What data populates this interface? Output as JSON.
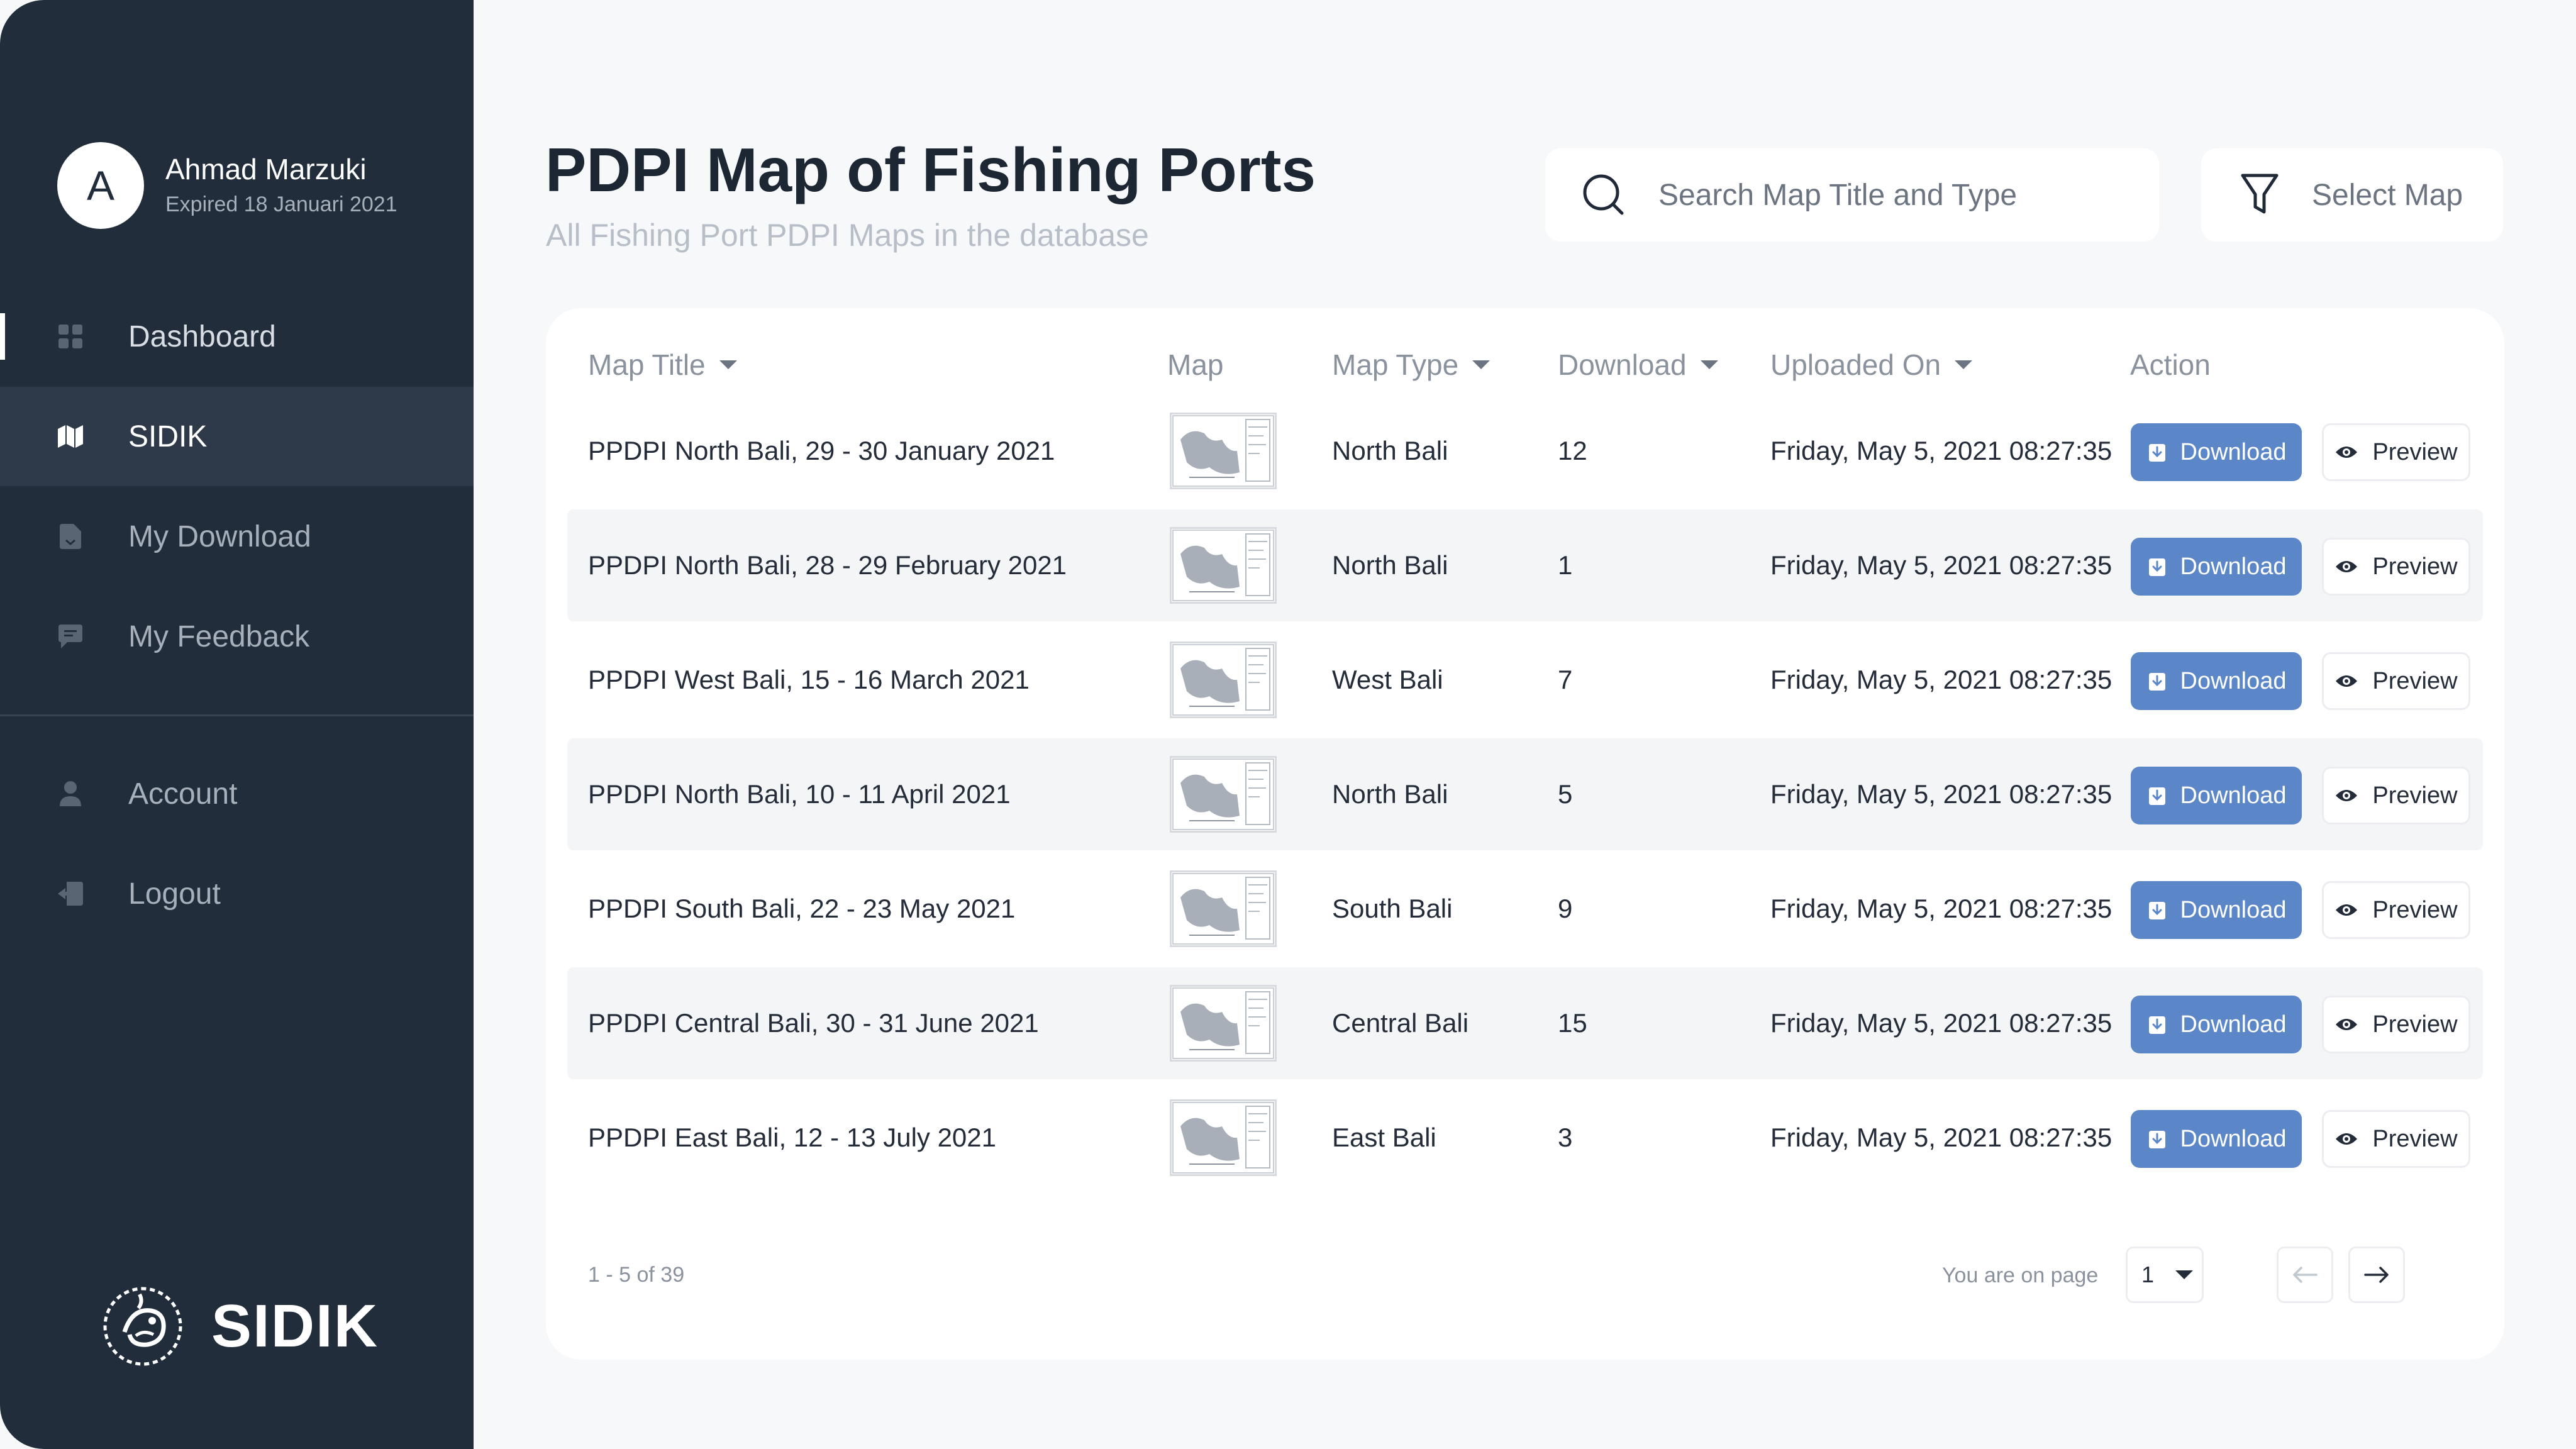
{
  "user": {
    "initial": "A",
    "name": "Ahmad Marzuki",
    "status": "Expired 18 Januari 2021"
  },
  "nav": {
    "items": [
      {
        "label": "Dashboard",
        "icon": "grid-icon"
      },
      {
        "label": "SIDIK",
        "icon": "map-icon"
      },
      {
        "label": "My Download",
        "icon": "document-icon"
      },
      {
        "label": "My Feedback",
        "icon": "chat-icon"
      }
    ],
    "secondary": [
      {
        "label": "Account",
        "icon": "user-icon"
      },
      {
        "label": "Logout",
        "icon": "logout-icon"
      }
    ],
    "active_index": 1
  },
  "brand": {
    "name": "SIDIK",
    "logo_icon": "fish-emblem-icon"
  },
  "page": {
    "title": "PDPI Map of Fishing Ports",
    "subtitle": "All Fishing Port PDPI Maps in the database"
  },
  "search": {
    "placeholder": "Search Map Title and Type",
    "value": ""
  },
  "filter": {
    "label": "Select Map"
  },
  "table": {
    "headers": {
      "title": "Map Title",
      "map": "Map",
      "type": "Map Type",
      "download": "Download",
      "uploaded": "Uploaded On",
      "action": "Action"
    },
    "rows": [
      {
        "title": "PPDPI North Bali, 29 - 30 January 2021",
        "type": "North Bali",
        "downloads": "12",
        "uploaded": "Friday, May 5, 2021 08:27:35"
      },
      {
        "title": "PPDPI North Bali, 28 - 29 February 2021",
        "type": "North Bali",
        "downloads": "1",
        "uploaded": "Friday, May 5, 2021 08:27:35"
      },
      {
        "title": "PPDPI West Bali, 15 - 16 March 2021",
        "type": "West Bali",
        "downloads": "7",
        "uploaded": "Friday, May 5, 2021 08:27:35"
      },
      {
        "title": "PPDPI North Bali, 10 - 11 April 2021",
        "type": "North Bali",
        "downloads": "5",
        "uploaded": "Friday, May 5, 2021 08:27:35"
      },
      {
        "title": "PPDPI South Bali, 22 - 23 May 2021",
        "type": "South Bali",
        "downloads": "9",
        "uploaded": "Friday, May 5, 2021 08:27:35"
      },
      {
        "title": "PPDPI Central Bali, 30 - 31 June 2021",
        "type": "Central Bali",
        "downloads": "15",
        "uploaded": "Friday, May 5, 2021 08:27:35"
      },
      {
        "title": "PPDPI East Bali, 12 - 13 July 2021",
        "type": "East Bali",
        "downloads": "3",
        "uploaded": "Friday, May 5, 2021 08:27:35"
      }
    ],
    "download_label": "Download",
    "preview_label": "Preview"
  },
  "pagination": {
    "range": "1 - 5 of 39",
    "page_label": "You are on page",
    "current_page": "1"
  },
  "colors": {
    "sidebar": "#212d3b",
    "sidebar_active": "#2e3a49",
    "primary": "#5b87c8",
    "background": "#f7f8f9"
  }
}
